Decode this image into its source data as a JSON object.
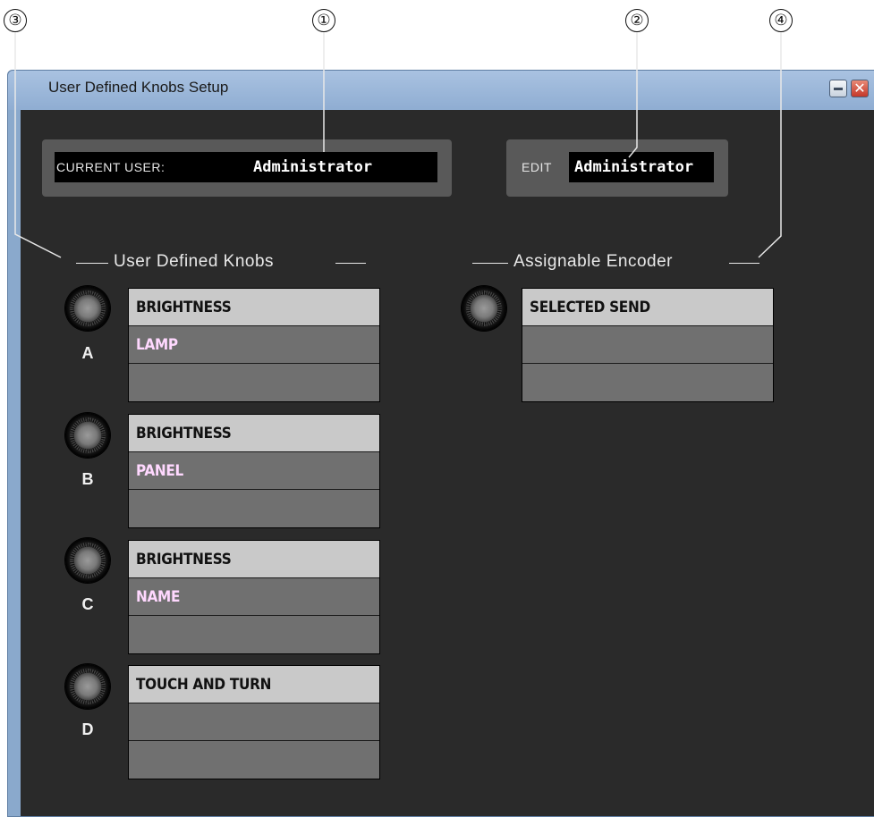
{
  "callouts": [
    "①",
    "②",
    "③",
    "④"
  ],
  "window": {
    "title": "User Defined Knobs Setup",
    "minimize_label": "",
    "close_label": "✕"
  },
  "current_user": {
    "label": "CURRENT USER:",
    "value": "Administrator"
  },
  "edit_user": {
    "label": "EDIT",
    "value": "Administrator"
  },
  "user_knobs": {
    "heading": "User Defined Knobs",
    "knobs": [
      {
        "letter": "A",
        "rows": [
          "BRIGHTNESS",
          "LAMP",
          ""
        ]
      },
      {
        "letter": "B",
        "rows": [
          "BRIGHTNESS",
          "PANEL",
          ""
        ]
      },
      {
        "letter": "C",
        "rows": [
          "BRIGHTNESS",
          "NAME",
          ""
        ]
      },
      {
        "letter": "D",
        "rows": [
          "TOUCH AND TURN",
          "",
          ""
        ]
      }
    ]
  },
  "assignable_encoder": {
    "heading": "Assignable Encoder",
    "rows": [
      "SELECTED SEND",
      "",
      ""
    ]
  },
  "icons": [
    "knob-icon",
    "minimize-icon",
    "close-icon"
  ]
}
